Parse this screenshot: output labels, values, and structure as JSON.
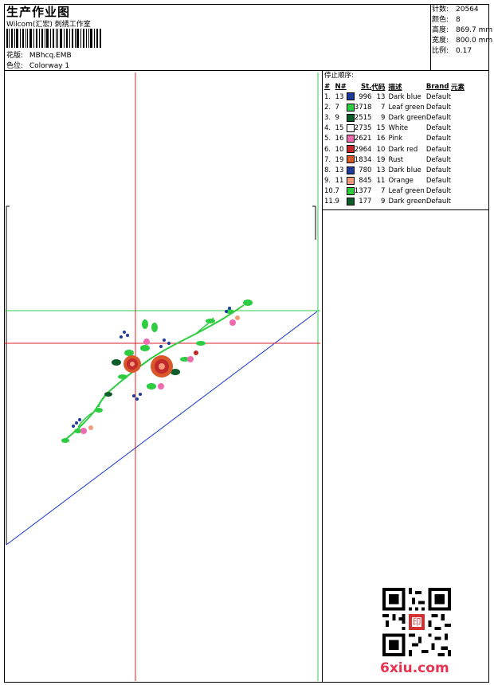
{
  "header": {
    "title": "生产作业图",
    "subtitle": "Wilcom(汇宏) 刺绣工作室",
    "design_label": "花版:",
    "design_value": "MBhcq.EMB",
    "colorway_label": "色位:",
    "colorway_value": "Colorway 1"
  },
  "stats": {
    "stitches_label": "针数:",
    "stitches_value": "20564",
    "colors_label": "颜色:",
    "colors_value": "8",
    "height_label": "高度:",
    "height_value": "869.7 mm",
    "width_label": "宽度:",
    "width_value": "800.0 mm",
    "scale_label": "比例:",
    "scale_value": "0.17"
  },
  "stop_sequence": {
    "title": "停止顺序:",
    "columns": {
      "idx": "#",
      "n": "N#",
      "st": "St.",
      "code": "代码",
      "desc": "描述",
      "brand": "Brand",
      "elem": "元素"
    },
    "rows": [
      {
        "idx": "1.",
        "n": "13",
        "color": "#1f3b9a",
        "st": "996",
        "code": "13",
        "desc": "Dark blue",
        "brand": "Default"
      },
      {
        "idx": "2.",
        "n": "7",
        "color": "#2ecc40",
        "st": "3718",
        "code": "7",
        "desc": "Leaf green",
        "brand": "Default"
      },
      {
        "idx": "3.",
        "n": "9",
        "color": "#0b5e2a",
        "st": "2515",
        "code": "9",
        "desc": "Dark green",
        "brand": "Default"
      },
      {
        "idx": "4.",
        "n": "15",
        "color": "#ffffff",
        "st": "2735",
        "code": "15",
        "desc": "White",
        "brand": "Default"
      },
      {
        "idx": "5.",
        "n": "16",
        "color": "#f06ab0",
        "st": "2621",
        "code": "16",
        "desc": "Pink",
        "brand": "Default"
      },
      {
        "idx": "6.",
        "n": "10",
        "color": "#c0282b",
        "st": "2964",
        "code": "10",
        "desc": "Dark red",
        "brand": "Default"
      },
      {
        "idx": "7.",
        "n": "19",
        "color": "#d9582b",
        "st": "1834",
        "code": "19",
        "desc": "Rust",
        "brand": "Default"
      },
      {
        "idx": "8.",
        "n": "13",
        "color": "#1f3b9a",
        "st": "780",
        "code": "13",
        "desc": "Dark blue",
        "brand": "Default"
      },
      {
        "idx": "9.",
        "n": "11",
        "color": "#f59b7a",
        "st": "845",
        "code": "11",
        "desc": "Orange",
        "brand": "Default"
      },
      {
        "idx": "10.",
        "n": "7",
        "color": "#2ecc40",
        "st": "1377",
        "code": "7",
        "desc": "Leaf green",
        "brand": "Default"
      },
      {
        "idx": "11.",
        "n": "9",
        "color": "#0b5e2a",
        "st": "177",
        "code": "9",
        "desc": "Dark green",
        "brand": "Default"
      }
    ]
  },
  "watermark": "6xiu.com",
  "stamp_text": "印"
}
